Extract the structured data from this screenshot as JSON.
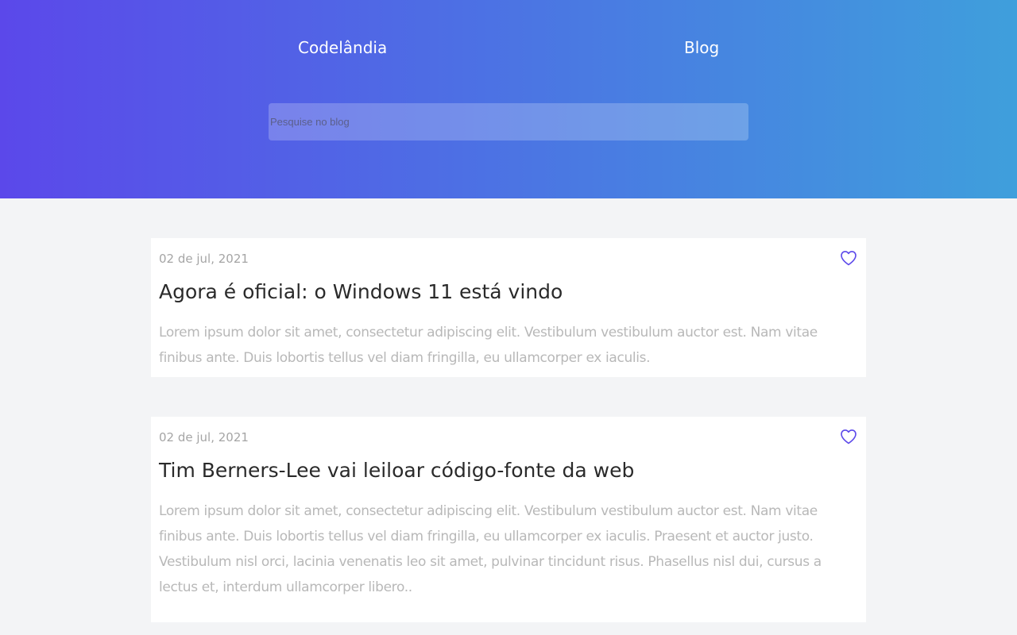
{
  "header": {
    "brand": "Codelândia",
    "nav_blog": "Blog",
    "search_placeholder": "Pesquise no blog",
    "gradient_colors": [
      "#5b48ea",
      "#4d6fe4",
      "#3f9fdc"
    ]
  },
  "posts": [
    {
      "date": "02 de jul, 2021",
      "title": "Agora é oficial: o Windows 11 está vindo",
      "body": "Lorem ipsum dolor sit amet, consectetur adipiscing elit. Vestibulum vestibulum auctor est. Nam vitae finibus ante. Duis lobortis tellus vel diam fringilla, eu ullamcorper ex iaculis.",
      "icon": "heart-outline-icon"
    },
    {
      "date": "02 de jul, 2021",
      "title": "Tim Berners-Lee vai leiloar código-fonte da web",
      "body": "Lorem ipsum dolor sit amet, consectetur adipiscing elit. Vestibulum vestibulum auctor est. Nam vitae finibus ante. Duis lobortis tellus vel diam fringilla, eu ullamcorper ex iaculis. Praesent et auctor justo. Vestibulum nisl orci, lacinia venenatis leo sit amet, pulvinar tincidunt risus. Phasellus nisl dui, cursus a lectus et, interdum ullamcorper libero..",
      "icon": "heart-outline-icon"
    }
  ],
  "colors": {
    "accent": "#5b48ea",
    "page_background": "#f3f4f6",
    "card_background": "#ffffff",
    "date_text": "#a5a5a5",
    "title_text": "#2a2a2a",
    "body_text": "#b8b8b8"
  }
}
